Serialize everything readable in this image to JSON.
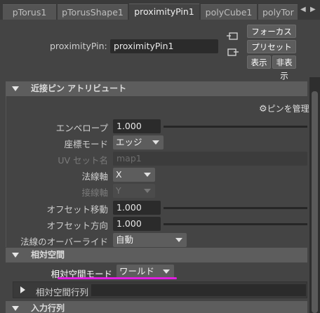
{
  "tabs": [
    {
      "label": "pTorus1",
      "active": false
    },
    {
      "label": "pTorusShape1",
      "active": false
    },
    {
      "label": "proximityPin1",
      "active": true
    },
    {
      "label": "polyCube1",
      "active": false
    },
    {
      "label": "polyTor",
      "active": false
    }
  ],
  "header": {
    "node_label": "proximityPin:",
    "node_name": "proximityPin1",
    "focus_button": "フォーカス",
    "preset_button": "プリセット",
    "show_button": "表示",
    "hide_button": "非表示"
  },
  "attributes_section": {
    "title": "近接ピン アトリビュート",
    "manage_pins": "ピンを管理",
    "envelope": {
      "label": "エンベロープ",
      "value": "1.000"
    },
    "coordinate_mode": {
      "label": "座標モード",
      "value": "エッジ"
    },
    "uv_set": {
      "label": "UV セット名",
      "value": "map1"
    },
    "normal_axis": {
      "label": "法線軸",
      "value": "X"
    },
    "tangent_axis": {
      "label": "接線軸",
      "value": "Y"
    },
    "offset_translate": {
      "label": "オフセット移動",
      "value": "1.000"
    },
    "offset_orient": {
      "label": "オフセット方向",
      "value": "1.000"
    },
    "normal_override": {
      "label": "法線のオーバーライド",
      "value": "自動"
    }
  },
  "relative_space_section": {
    "title": "相対空間",
    "mode": {
      "label": "相対空間モード",
      "value": "ワールド"
    },
    "matrix_label": "相対空間行列"
  },
  "input_matrix_section": {
    "title": "入力行列"
  },
  "colors": {
    "highlight_underline": "#e01ee0"
  }
}
